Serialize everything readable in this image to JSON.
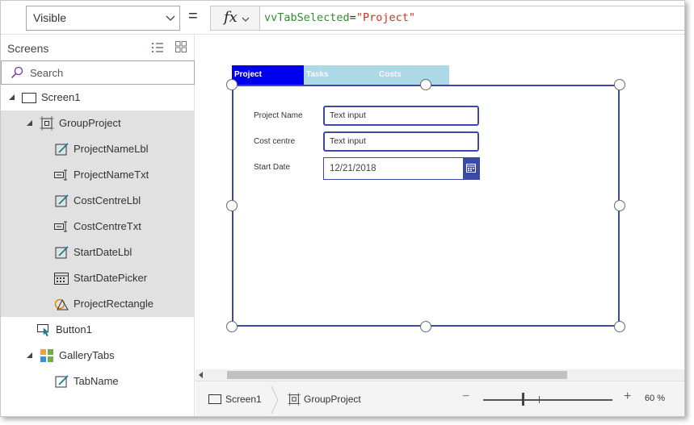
{
  "formula_bar": {
    "property": "Visible",
    "equals": "=",
    "fx_label": "fx",
    "formula_ident": "vvTabSelected",
    "formula_op": "=",
    "formula_str": "\"Project\""
  },
  "tree": {
    "title": "Screens",
    "search_placeholder": "Search",
    "items": [
      {
        "label": "Screen1",
        "icon": "screen-icon"
      },
      {
        "label": "GroupProject",
        "icon": "group-icon"
      },
      {
        "label": "ProjectNameLbl",
        "icon": "label-edit-icon"
      },
      {
        "label": "ProjectNameTxt",
        "icon": "text-input-icon"
      },
      {
        "label": "CostCentreLbl",
        "icon": "label-edit-icon"
      },
      {
        "label": "CostCentreTxt",
        "icon": "text-input-icon"
      },
      {
        "label": "StartDateLbl",
        "icon": "label-edit-icon"
      },
      {
        "label": "StartDatePicker",
        "icon": "calendar-icon"
      },
      {
        "label": "ProjectRectangle",
        "icon": "shapes-icon"
      },
      {
        "label": "Button1",
        "icon": "button-pointer-icon"
      },
      {
        "label": "GalleryTabs",
        "icon": "gallery-icon"
      },
      {
        "label": "TabName",
        "icon": "label-edit-icon"
      }
    ]
  },
  "canvas": {
    "tabs": [
      "Project",
      "Tasks",
      "Costs"
    ],
    "fields": {
      "project_name_label": "Project Name",
      "project_name_value": "Text input",
      "cost_centre_label": "Cost centre",
      "cost_centre_value": "Text input",
      "start_date_label": "Start Date",
      "start_date_value": "12/21/2018"
    }
  },
  "status_bar": {
    "crumb_screen": "Screen1",
    "crumb_group": "GroupProject",
    "zoom_minus": "−",
    "zoom_plus": "+",
    "zoom_level": "60  %"
  },
  "colors": {
    "accent": "#3b4aa6",
    "active_tab": "#0000ee",
    "inactive_tab": "#add8e6",
    "selection": "#e1e1e1"
  }
}
